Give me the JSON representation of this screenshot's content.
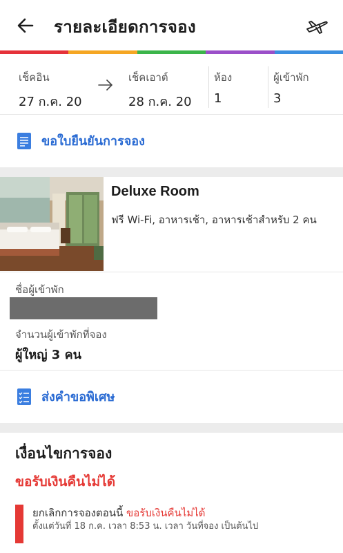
{
  "header": {
    "title": "รายละเอียดการจอง",
    "back_icon": "arrow-left-icon",
    "action_icon": "airplane-icon"
  },
  "theme": {
    "rainbow": [
      "#e5323a",
      "#f5a623",
      "#3bb54a",
      "#9b4fc9",
      "#3b8fe0"
    ],
    "link": "#2a6bd3",
    "alert": "#e53935"
  },
  "stay": {
    "checkin_label": "เช็คอิน",
    "checkin_date": "27 ก.ค. 20",
    "checkout_label": "เช็คเอาต์",
    "checkout_date": "28 ก.ค. 20",
    "rooms_label": "ห้อง",
    "rooms_value": "1",
    "guests_label": "ผู้เข้าพัก",
    "guests_value": "3"
  },
  "confirmation_link": {
    "label": "ขอใบยืนยันการจอง",
    "icon": "document-icon"
  },
  "room": {
    "name": "Deluxe Room",
    "amenities": "ฟรี Wi-Fi, อาหารเช้า, อาหารเช้าสำหรับ 2 คน"
  },
  "guest": {
    "name_label": "ชื่อผู้เข้าพัก",
    "count_label": "จำนวนผู้เข้าพักที่จอง",
    "count_value": "ผู้ใหญ่ 3 คน"
  },
  "special_request": {
    "label": "ส่งคำขอพิเศษ",
    "icon": "checklist-icon"
  },
  "policy": {
    "title": "เงื่อนไขการจอง",
    "refund_status": "ขอรับเงินคืนไม่ได้",
    "line1_prefix": "ยกเลิกการจองตอนนี้",
    "line1_highlight": "ขอรับเงินคืนไม่ได้",
    "line2": "ตั้งแต่วันที่ 18 ก.ค. เวลา 8:53 น. เวลา วันที่จอง เป็นต้นไป"
  }
}
